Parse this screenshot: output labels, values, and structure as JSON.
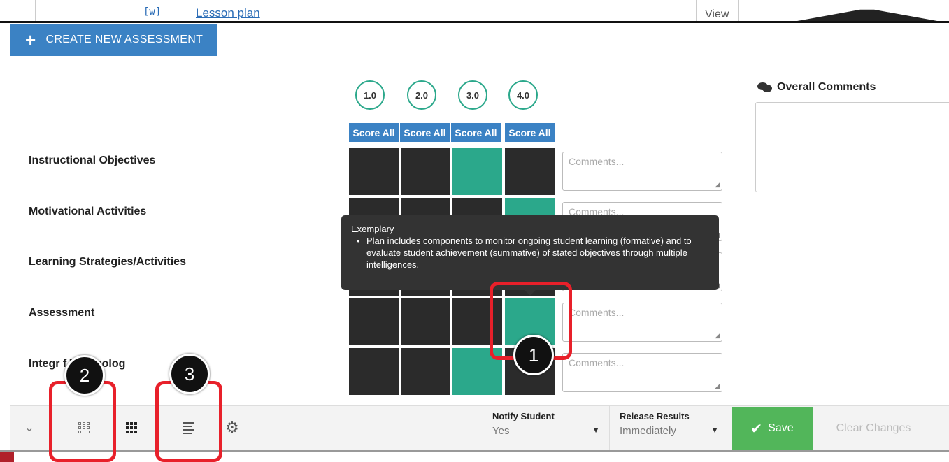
{
  "top_row": {
    "icon": "[w]",
    "link_label": "Lesson plan",
    "view_label": "View"
  },
  "create_button": {
    "icon": "plus-icon",
    "label": "CREATE NEW ASSESSMENT"
  },
  "rubric": {
    "levels": [
      "1.0",
      "2.0",
      "3.0",
      "4.0"
    ],
    "score_all_label": "Score All",
    "criteria": [
      {
        "label": "Instructional Objectives",
        "selected_level": 3
      },
      {
        "label": "Motivational Activities",
        "selected_level": 4
      },
      {
        "label": "Learning Strategies/Activities",
        "selected_level": null
      },
      {
        "label": "Assessment",
        "selected_level": 4
      },
      {
        "label": "Integr f Technolog",
        "selected_level": 3
      }
    ],
    "comment_placeholder": "Comments..."
  },
  "tooltip": {
    "title": "Exemplary",
    "body": "Plan includes components to monitor ongoing student learning (formative) and to evaluate student achievement (summative) of stated objectives through multiple intelligences."
  },
  "overall_comments": {
    "icon": "comments-icon",
    "title": "Overall Comments"
  },
  "toolbar": {
    "collapse_icon": "chevron-down-icon",
    "grid_outline_icon": "grid-outline-icon",
    "grid_solid_icon": "grid-solid-icon",
    "list_icon": "list-icon",
    "settings_icon": "gear-icon",
    "notify": {
      "label": "Notify Student",
      "value": "Yes"
    },
    "release": {
      "label": "Release Results",
      "value": "Immediately"
    },
    "save_label": "Save",
    "clear_label": "Clear Changes"
  },
  "annotations": [
    "1",
    "2",
    "3"
  ],
  "colors": {
    "accent_blue": "#3b82c4",
    "selected_teal": "#2ba88b",
    "cell_dark": "#2b2b2b",
    "save_green": "#52b65a",
    "annotation_red": "#e8202a"
  }
}
